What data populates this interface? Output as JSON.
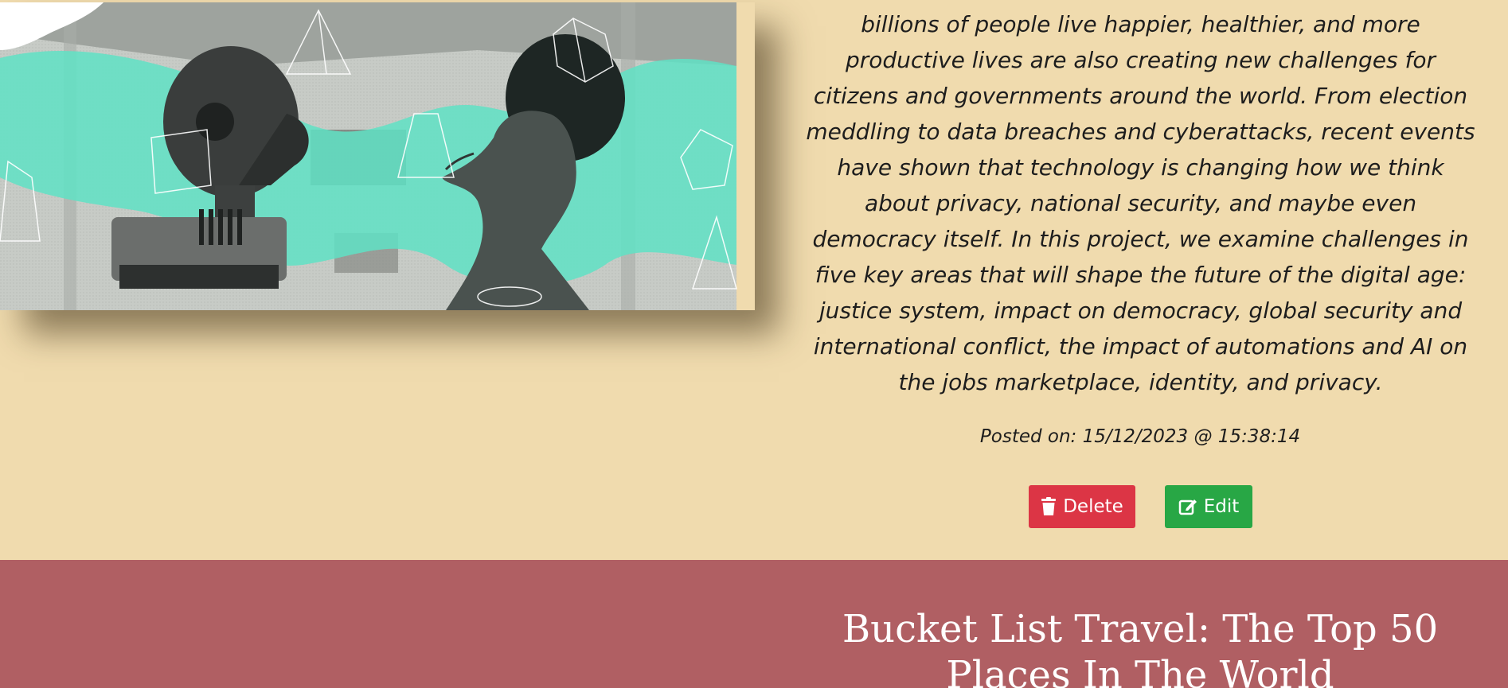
{
  "post": {
    "image_alt": "Illustration of a robot bust facing a woman's profile with geometric shapes",
    "body": "billions of people live happier, healthier, and more productive lives are also creating new challenges for citizens and governments around the world. From election meddling to data breaches and cyberattacks, recent events have shown that technology is changing how we think about privacy, national security, and maybe even democracy itself. In this project, we examine challenges in five key areas that will shape the future of the digital age: justice system, impact on democracy, global security and international conflict, the impact of automations and AI on the jobs marketplace, identity, and privacy.",
    "posted_on": "Posted on: 15/12/2023 @ 15:38:14",
    "actions": {
      "delete_label": "Delete",
      "edit_label": "Edit",
      "delete_icon": "trash-icon",
      "edit_icon": "edit-icon"
    }
  },
  "next_post": {
    "title": "Bucket List Travel: The Top 50 Places In The World"
  },
  "colors": {
    "page_background": "#f0dbae",
    "next_post_background": "#b05f63",
    "delete": "#dc3545",
    "edit": "#28a745",
    "teal_accent": "#5fe2c4"
  }
}
